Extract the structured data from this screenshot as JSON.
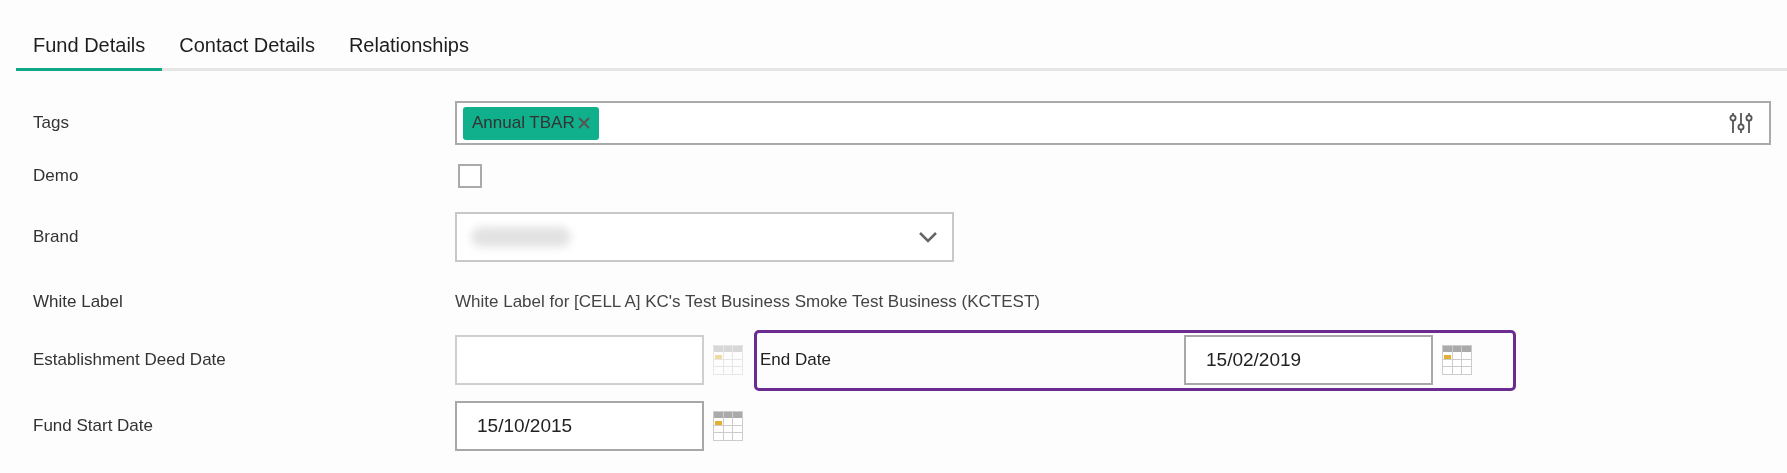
{
  "tabs": [
    {
      "label": "Fund Details",
      "selected": true
    },
    {
      "label": "Contact Details",
      "selected": false
    },
    {
      "label": "Relationships",
      "selected": false
    }
  ],
  "fields": [
    {
      "kind": "tags",
      "label": "Tags",
      "tags": [
        {
          "text": "Annual TBAR",
          "color": "#10b08c"
        }
      ]
    },
    {
      "kind": "checkbox",
      "label": "Demo",
      "checked": false
    },
    {
      "kind": "select",
      "label": "Brand"
    },
    {
      "kind": "text",
      "label": "White Label",
      "value": "White Label for [CELL A] KC's Test Business Smoke Test Business (KCTEST)"
    },
    {
      "kind": "date",
      "label": "Establishment Deed Date",
      "disabled": true,
      "extra": {
        "label": "End Date",
        "value": "15/02/2019",
        "highlighted": true
      }
    },
    {
      "kind": "date",
      "label": "Fund Start Date",
      "value": "15/10/2015",
      "disabled": false
    }
  ]
}
